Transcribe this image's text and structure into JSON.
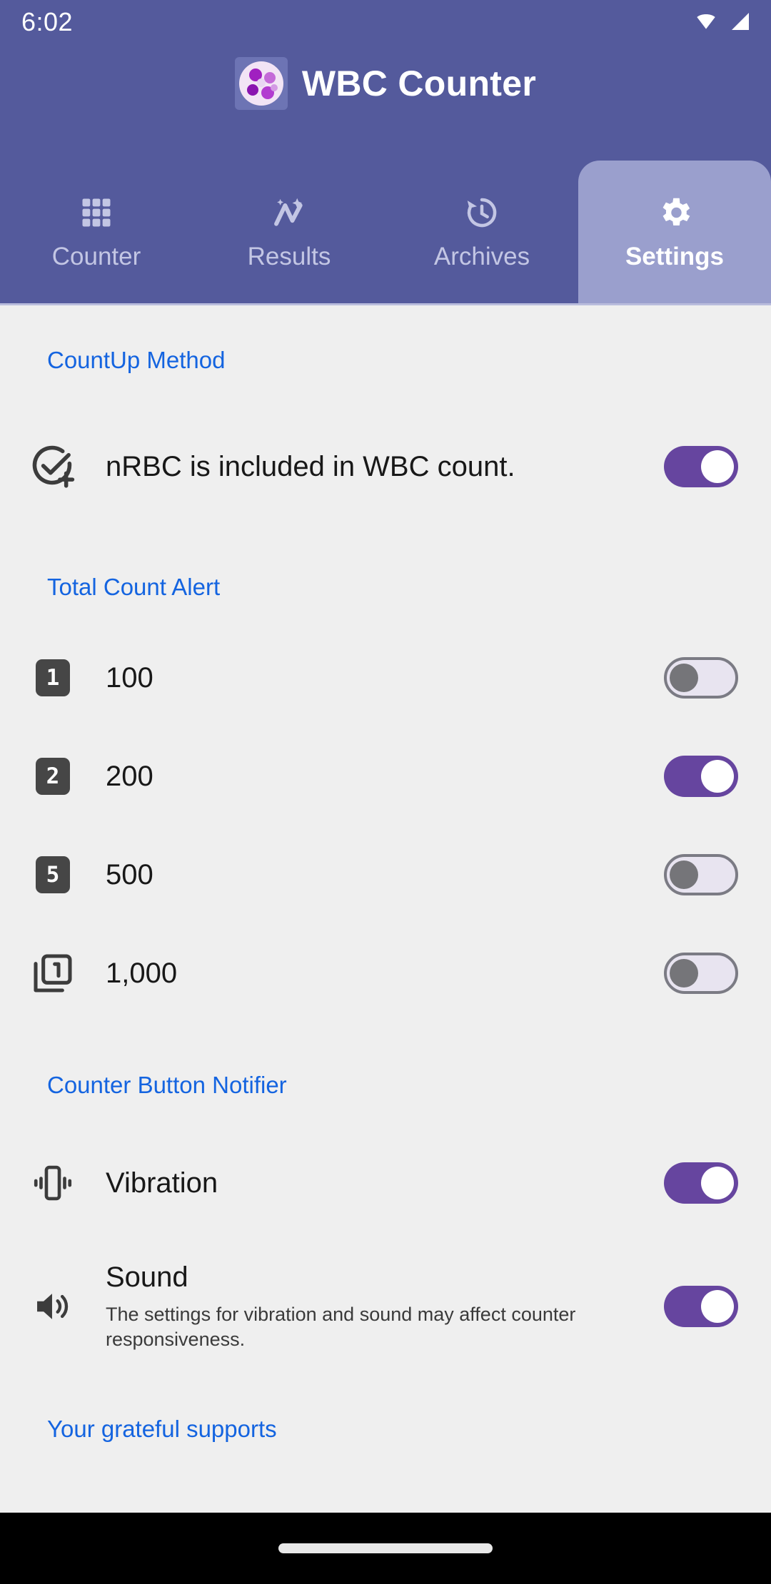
{
  "status_bar": {
    "time": "6:02",
    "wifi_icon": "wifi-icon",
    "signal_icon": "cellular-signal-icon"
  },
  "app_bar": {
    "logo_icon": "wbc-cells-logo-icon",
    "title": "WBC Counter"
  },
  "tabs": [
    {
      "label": "Counter",
      "icon": "grid-icon",
      "active": false
    },
    {
      "label": "Results",
      "icon": "analytics-spark-icon",
      "active": false
    },
    {
      "label": "Archives",
      "icon": "history-clock-icon",
      "active": false
    },
    {
      "label": "Settings",
      "icon": "gear-icon",
      "active": true
    }
  ],
  "sections": [
    {
      "title": "CountUp Method",
      "rows": [
        {
          "icon": "check-circle-plus-icon",
          "title": "nRBC is included in WBC count.",
          "subtitle": "",
          "toggle": "on"
        }
      ]
    },
    {
      "title": "Total Count Alert",
      "rows": [
        {
          "icon": "badge-1-icon",
          "badge": "1",
          "title": "100",
          "subtitle": "",
          "toggle": "off"
        },
        {
          "icon": "badge-2-icon",
          "badge": "2",
          "title": "200",
          "subtitle": "",
          "toggle": "on"
        },
        {
          "icon": "badge-5-icon",
          "badge": "5",
          "title": "500",
          "subtitle": "",
          "toggle": "off"
        },
        {
          "icon": "filter-1-layer-icon",
          "badge": "1",
          "title": "1,000",
          "subtitle": "",
          "toggle": "off"
        }
      ]
    },
    {
      "title": "Counter Button Notifier",
      "rows": [
        {
          "icon": "vibration-icon",
          "title": "Vibration",
          "subtitle": "",
          "toggle": "on"
        },
        {
          "icon": "volume-up-icon",
          "title": "Sound",
          "subtitle": "The settings for vibration and sound may affect counter responsiveness.",
          "toggle": "on"
        }
      ]
    },
    {
      "title": "Your grateful supports",
      "rows": []
    }
  ],
  "colors": {
    "header_purple": "#545a9c",
    "active_tab": "#9a9fcd",
    "section_blue": "#1464e0",
    "toggle_on": "#66459f",
    "toggle_off_track": "#e8e4f0",
    "badge_dark": "#464646",
    "page_background": "#efefef"
  },
  "nav_bar": {
    "home_pill": "home-gesture-pill"
  }
}
